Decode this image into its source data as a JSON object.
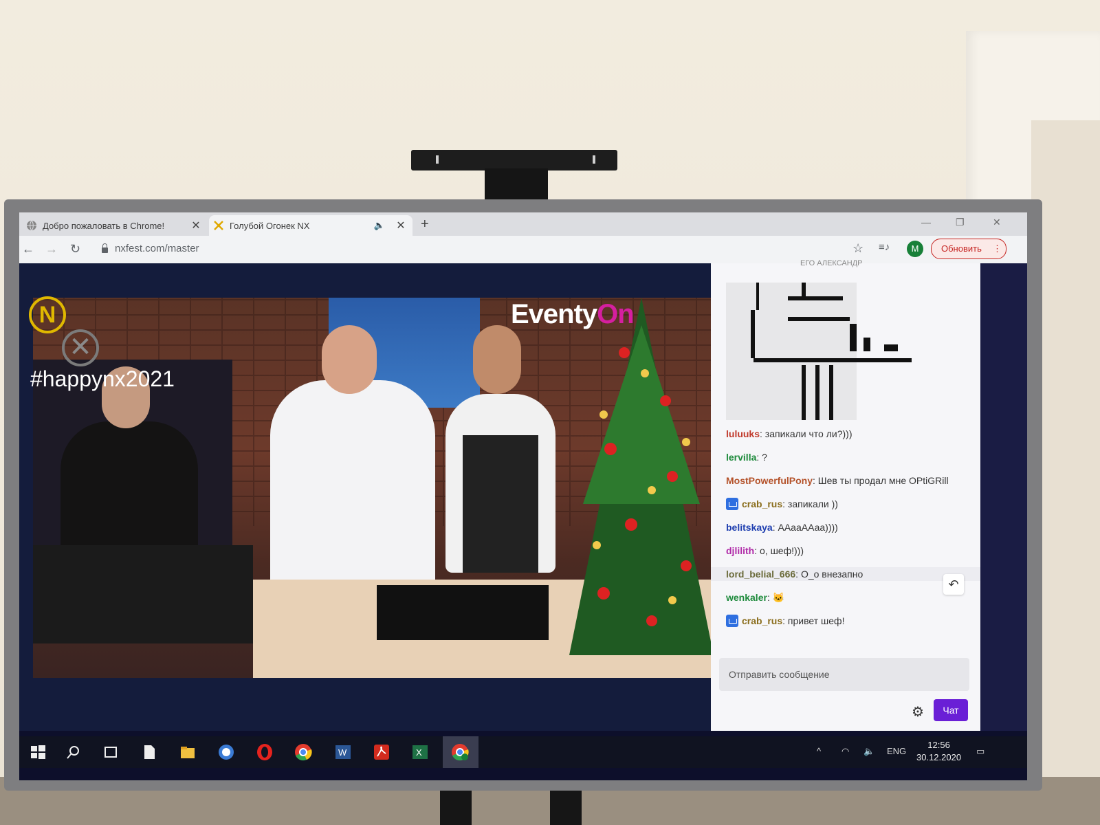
{
  "tabs": [
    {
      "title": "Добро пожаловать в Chrome!",
      "close": "✕"
    },
    {
      "title": "Голубой Огонек NX",
      "close": "✕",
      "audio": "🔈"
    }
  ],
  "new_tab": "+",
  "window_controls": {
    "minimize": "—",
    "restore": "❐",
    "close": "✕"
  },
  "address_bar": {
    "url": "nxfest.com/master"
  },
  "nav_icons": {
    "back": "←",
    "forward": "→",
    "reload": "↻"
  },
  "toolbar": {
    "star": "☆",
    "media": "≡♪",
    "avatar_letter": "M",
    "update_label": "Обновить"
  },
  "video": {
    "hashtag": "#happynx2021",
    "brand_part1": "Eventy",
    "brand_part2": "On",
    "logo_n": "N"
  },
  "chat": {
    "header_partial": "ЕГО АЛЕКСАНДР",
    "messages": [
      {
        "user": "luluuks",
        "text": ": запикали что ли?)))",
        "color": "#c0392b",
        "badge": false
      },
      {
        "user": "lervilla",
        "text": ": ?",
        "color": "#1e8a3c",
        "badge": false
      },
      {
        "user": "MostPowerfulPony",
        "text": ": Шев ты продал мне OPtiGRill",
        "color": "#b4522a",
        "badge": false
      },
      {
        "user": "crab_rus",
        "text": ": запикали ))",
        "color": "#8a6d1c",
        "badge": true
      },
      {
        "user": "belitskaya",
        "text": ": АAааААаа))))",
        "color": "#1f3fb0",
        "badge": false
      },
      {
        "user": "djlilith",
        "text": ": о, шеф!)))",
        "color": "#b02ba8",
        "badge": false
      },
      {
        "user": "lord_belial_666",
        "text": ": О_о внезапно",
        "color": "#6b6b3b",
        "badge": false,
        "highlight": true
      },
      {
        "user": "wenkaler",
        "text": ": ",
        "color": "#1e8a3c",
        "badge": false,
        "emote": "🐱"
      },
      {
        "user": "crab_rus",
        "text": ": привет шеф!",
        "color": "#8a6d1c",
        "badge": true
      }
    ],
    "input_placeholder": "Отправить сообщение",
    "send_label": "Чат",
    "settings_icon": "⚙",
    "reply_icon": "↶"
  },
  "taskbar": {
    "tray": {
      "chevron": "^",
      "lang": "ENG",
      "time": "12:56",
      "date": "30.12.2020"
    }
  },
  "colors": {
    "accent": "#6a1fd6",
    "brand_pink": "#d51fa0",
    "update_red": "#c5221f"
  }
}
